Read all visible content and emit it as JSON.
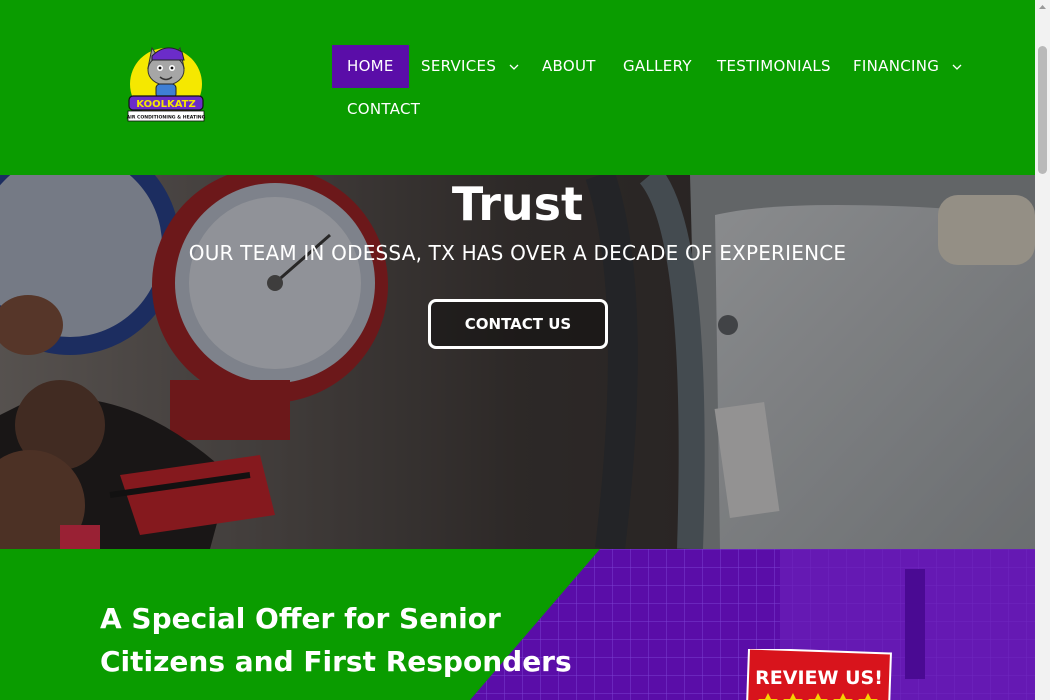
{
  "brand": {
    "logo_text": "KOOLKATZ",
    "logo_tagline": "AIR CONDITIONING & HEATING"
  },
  "nav": {
    "items": [
      {
        "label": "HOME",
        "active": true
      },
      {
        "label": "SERVICES",
        "dropdown": true
      },
      {
        "label": "ABOUT"
      },
      {
        "label": "GALLERY"
      },
      {
        "label": "TESTIMONIALS"
      },
      {
        "label": "FINANCING",
        "dropdown": true
      },
      {
        "label": "CONTACT"
      }
    ]
  },
  "hero": {
    "title": "Trust",
    "subtitle": "OUR TEAM IN ODESSA, TX HAS OVER A DECADE OF EXPERIENCE",
    "cta_label": "CONTACT US"
  },
  "offer": {
    "title": "A Special Offer for Senior Citizens and First Responders",
    "review_badge": "REVIEW US!"
  },
  "colors": {
    "brand_green": "#0a9c00",
    "brand_purple": "#5a0da8",
    "text": "#ffffff"
  }
}
